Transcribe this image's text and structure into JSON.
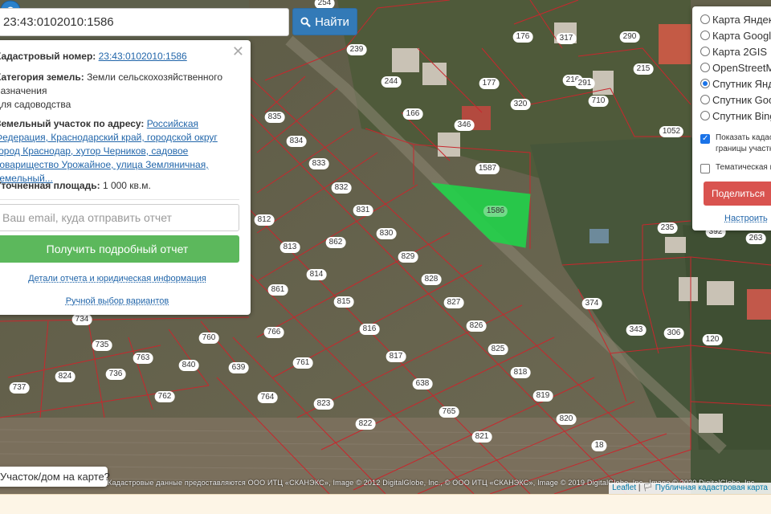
{
  "search": {
    "value": "23:43:0102010:1586",
    "button_label": "Найти"
  },
  "popup": {
    "cadastral_label": "Кадастровый номер:",
    "cadastral_value": "23:43:0102010:1586",
    "category_label": "Категория земель:",
    "category_value": "Земли сельскохозяйственного назначения",
    "usage_value": "для садоводства",
    "address_label": "Земельный участок по адресу:",
    "address_value": "Российская Федерация, Краснодарский край, городской округ город Краснодар, хутор Черников, садовое товарищество Урожайное, улица Земляничная, земельный...",
    "area_label": "Уточненная площадь:",
    "area_value": "1 000 кв.м.",
    "email_placeholder": "Ваш email, куда отправить отчет",
    "report_button": "Получить подробный отчет",
    "details_link": "Детали отчета и юридическая информация",
    "manual_link": "Ручной выбор вариантов"
  },
  "layers": {
    "options": [
      {
        "label": "Карта Яндекс",
        "checked": false
      },
      {
        "label": "Карта Google",
        "checked": false
      },
      {
        "label": "Карта 2GIS",
        "checked": false
      },
      {
        "label": "OpenStreetMap",
        "checked": false
      },
      {
        "label": "Спутник Яндекс",
        "checked": true
      },
      {
        "label": "Спутник Google",
        "checked": false
      },
      {
        "label": "Спутник Bing",
        "checked": false
      }
    ],
    "show_boundaries_line1": "Показать кадастровые",
    "show_boundaries_line2": "границы участков",
    "thematic_label": "Тематическая карта",
    "share_button": "Поделиться",
    "configure_link": "Настроить"
  },
  "map": {
    "selected_parcel": "1586",
    "parcel_numbers": [
      "254",
      "239",
      "244",
      "176",
      "290",
      "317",
      "216",
      "215",
      "166",
      "177",
      "291",
      "320",
      "710",
      "346",
      "1052",
      "835",
      "834",
      "1587",
      "833",
      "832",
      "831",
      "830",
      "812",
      "813",
      "862",
      "829",
      "814",
      "828",
      "861",
      "815",
      "827",
      "826",
      "816",
      "734",
      "766",
      "760",
      "825",
      "817",
      "735",
      "736",
      "763",
      "761",
      "840",
      "639",
      "824",
      "818",
      "638",
      "737",
      "762",
      "764",
      "823",
      "819",
      "765",
      "822",
      "820",
      "821",
      "18",
      "235",
      "263",
      "392",
      "374",
      "343",
      "306",
      "120"
    ],
    "question": "Участок/дом на карте?"
  },
  "attribution": {
    "text": "Кадастровые данные предоставляются ООО ИТЦ «СКАНЭКС», Image © 2012 DigitalGlobe, Inc., © ООО ИТЦ «СКАНЭКС», Image © 2019 DigitalGlobe, Inc., Image © 2020 DigitalGlobe, Inc.",
    "leaflet": "Leaflet",
    "public_map": "Публичная кадастровая карта"
  },
  "colors": {
    "parcel_line": "#c8272d",
    "selected_fill": "#22d24a",
    "search_button": "#337ab7",
    "report_button": "#5cb85c",
    "share_button": "#d9534f"
  }
}
